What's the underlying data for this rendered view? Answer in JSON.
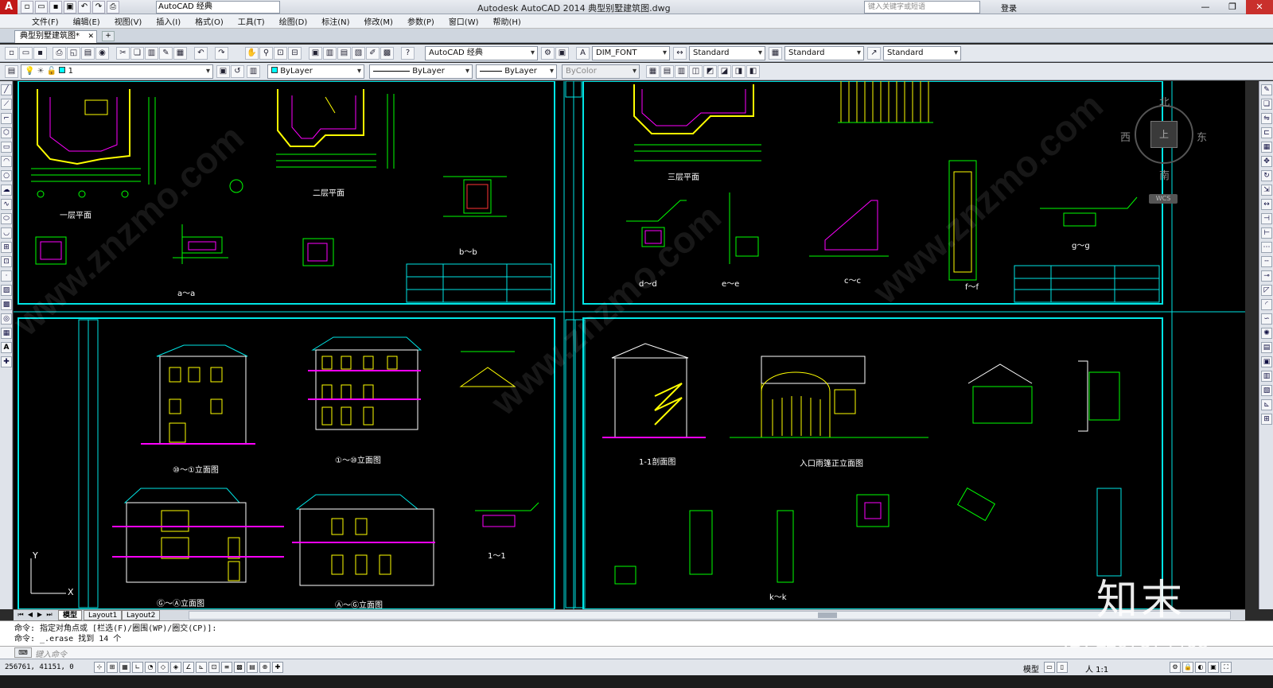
{
  "titlebar": {
    "app_logo": "A",
    "workspace": "AutoCAD 经典",
    "title": "Autodesk AutoCAD 2014    典型别墅建筑图.dwg",
    "search_placeholder": "键入关键字或短语",
    "login": "登录"
  },
  "menu": [
    "文件(F)",
    "编辑(E)",
    "视图(V)",
    "插入(I)",
    "格式(O)",
    "工具(T)",
    "绘图(D)",
    "标注(N)",
    "修改(M)",
    "参数(P)",
    "窗口(W)",
    "帮助(H)"
  ],
  "doc_tab": {
    "label": "典型别墅建筑图*",
    "close": "✕"
  },
  "toolbar1": {
    "workspace_select": "AutoCAD 经典",
    "text_style": "DIM_FONT",
    "dim_style": "Standard",
    "table_style": "Standard",
    "multileader_style": "Standard"
  },
  "toolbar2": {
    "layer": "1",
    "color": "ByLayer",
    "linetype": "ByLayer",
    "lineweight": "ByLayer",
    "plotstyle": "ByColor"
  },
  "viewcube": {
    "north": "北",
    "south": "南",
    "west": "西",
    "east": "东",
    "face": "上",
    "wcs": "WCS"
  },
  "drawing_labels": {
    "plan1": "一层平面",
    "plan2": "二层平面",
    "plan3": "三层平面",
    "detail_aa": "a～a",
    "detail_bb": "b～b",
    "detail_dd": "d～d",
    "detail_ee": "e～e",
    "detail_cc": "c～c",
    "detail_ff": "f～f",
    "detail_gg": "g～g",
    "elev1": "⑩～①立面图",
    "elev2": "①～⑩立面图",
    "elev3": "Ⓖ～Ⓐ立面图",
    "elev4": "Ⓐ～Ⓖ立面图",
    "section11": "1-1剖面图",
    "entrance": "入口雨篷正立面图",
    "detail_11": "1～1",
    "detail_kk": "k～k"
  },
  "layout_tabs": [
    "模型",
    "Layout1",
    "Layout2"
  ],
  "command_history": [
    "命令: 指定对角点或 [栏选(F)/圈围(WP)/圈交(CP)]:",
    "命令: _.erase 找到 14 个"
  ],
  "command_placeholder": "键入命令",
  "status": {
    "coords": "256761, 41151, 0",
    "model": "模型",
    "scale": "人 1:1"
  },
  "watermark": {
    "brand": "知末",
    "id": "ID: 1107574468",
    "site": "www.znzmo.com"
  },
  "colors": {
    "canvas": "#000000",
    "frame": "#00e5e5",
    "wall": "#ffff00",
    "dim": "#00ff00",
    "accent": "#ff00ff",
    "logo": "#c11818"
  }
}
